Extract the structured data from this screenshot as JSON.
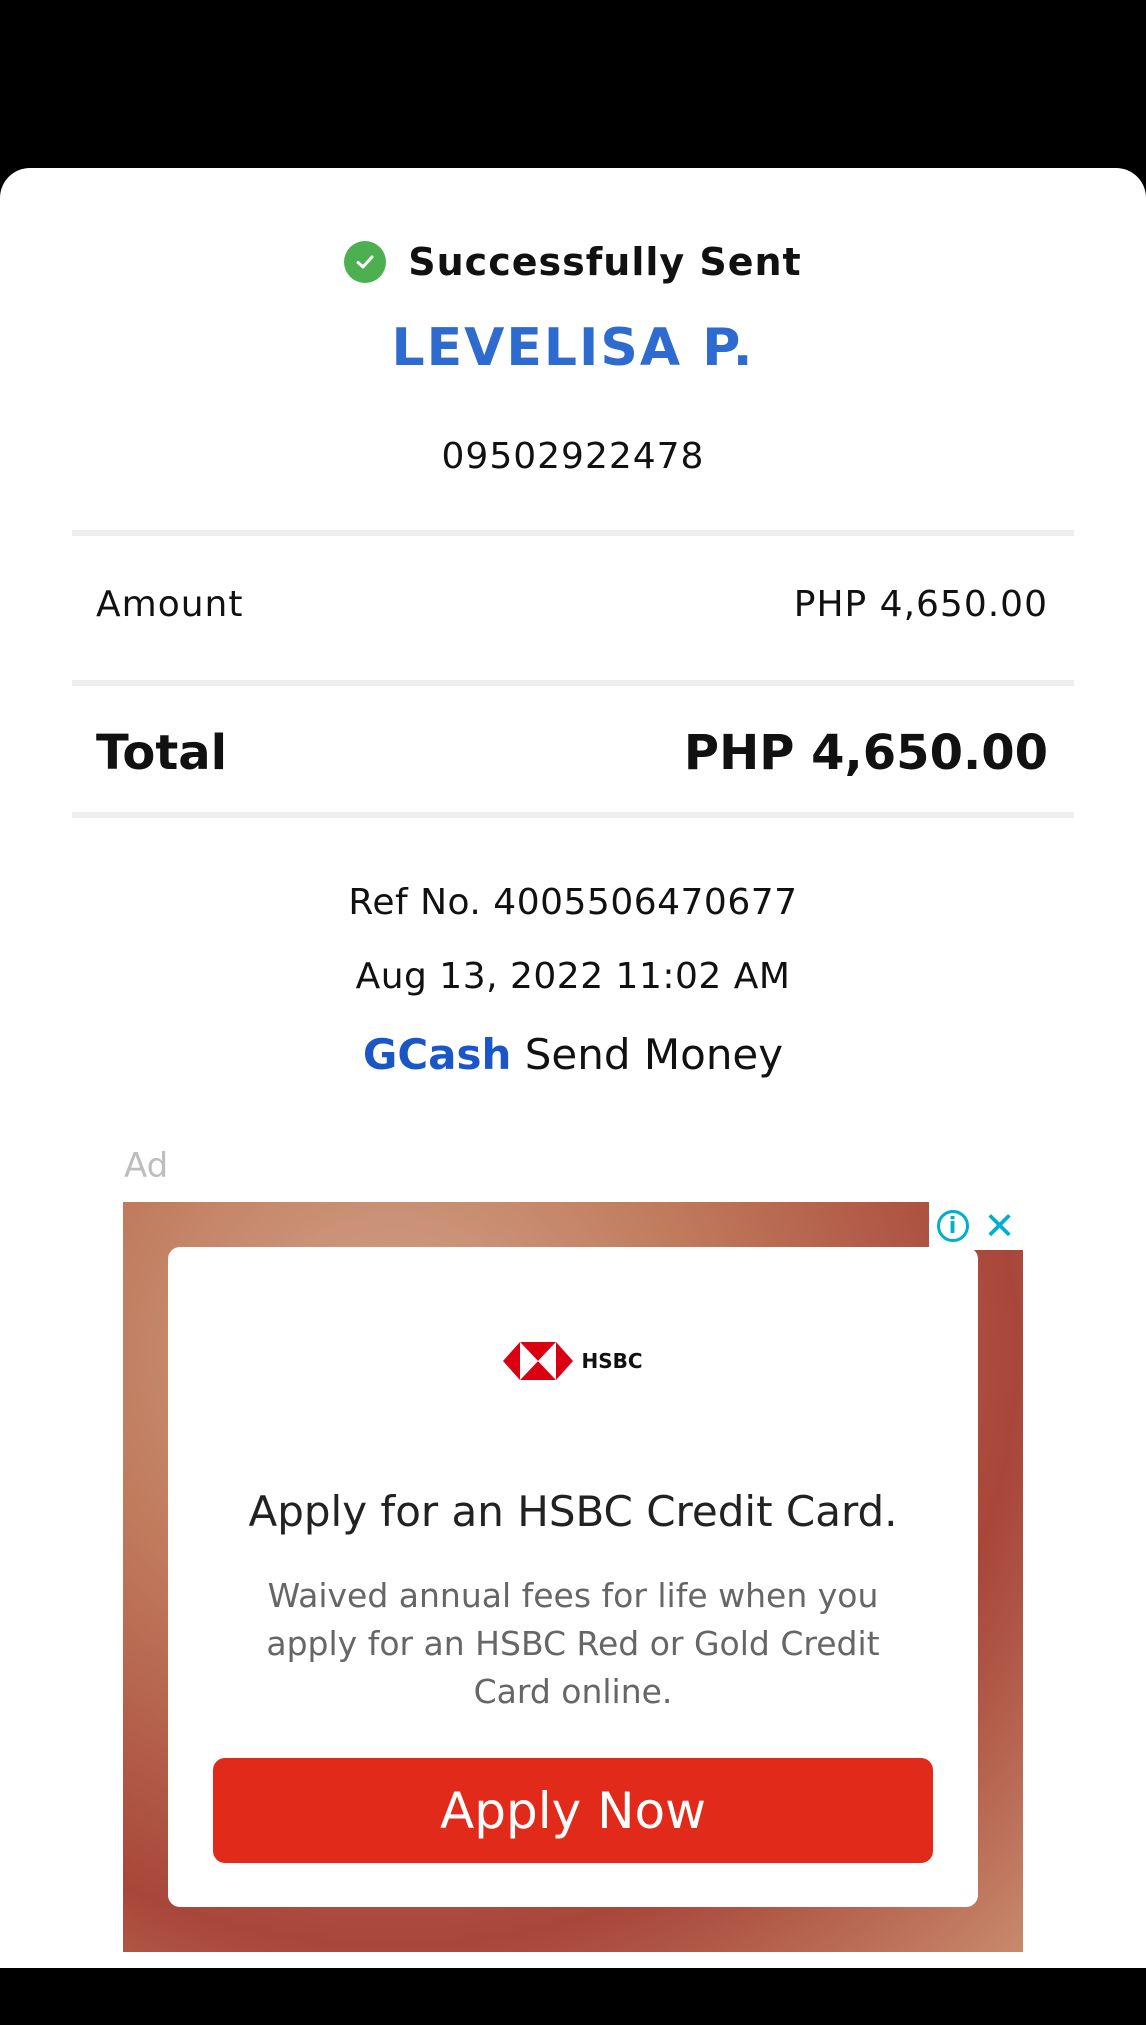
{
  "receipt": {
    "status_text": "Successfully Sent",
    "recipient_name": "LEVELISA P.",
    "recipient_number": "09502922478",
    "amount_label": "Amount",
    "amount_value": "PHP 4,650.00",
    "total_label": "Total",
    "total_value": "PHP 4,650.00",
    "ref_no": "Ref No. 4005506470677",
    "datetime": "Aug 13, 2022 11:02 AM",
    "service_brand": "GCash",
    "service_name": "Send Money"
  },
  "ad": {
    "label": "Ad",
    "brand": "HSBC",
    "headline": "Apply for an HSBC Credit Card.",
    "body": "Waived annual fees for life when you apply for an HSBC Red or Gold Credit Card online.",
    "cta_label": "Apply Now",
    "icons": [
      "info-icon",
      "close-icon"
    ]
  },
  "colors": {
    "success": "#4caf50",
    "recipient": "#2e6bd0",
    "gcash": "#1a56c7",
    "cta": "#e22a1a",
    "ad_controls": "#00aecd"
  }
}
